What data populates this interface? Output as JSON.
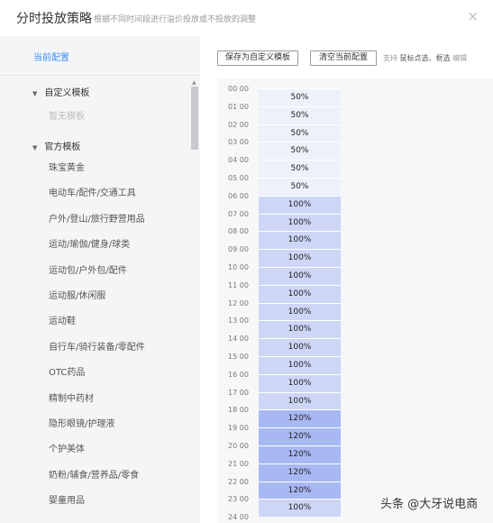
{
  "header": {
    "title": "分时投放策略",
    "subtitle": "根据不同时间段进行溢价投放或不投放的调整",
    "close_icon": "×"
  },
  "sidebar": {
    "current_config": "当前配置",
    "custom_group": {
      "label": "自定义模板",
      "empty": "暂无模板"
    },
    "official_group": {
      "label": "官方模板",
      "items": [
        "珠宝黄金",
        "电动车/配件/交通工具",
        "户外/登山/旅行野营用品",
        "运动/瑜伽/健身/球类",
        "运动包/户外包/配件",
        "运动服/休闲服",
        "运动鞋",
        "自行车/骑行装备/零配件",
        "OTC药品",
        "精制中药材",
        "隐形眼镜/护理液",
        "个护美体",
        "奶粉/辅食/营养品/零食",
        "婴童用品"
      ]
    }
  },
  "toolbar": {
    "save_label": "保存为自定义模板",
    "clear_label": "清空当前配置",
    "hint_prefix": "支持",
    "hint_highlight": "鼠标点选、框选",
    "hint_suffix": "编辑"
  },
  "schedule": {
    "hours": [
      "00 00",
      "01 00",
      "02 00",
      "03 00",
      "04 00",
      "05 00",
      "06 00",
      "07 00",
      "08 00",
      "09 00",
      "10 00",
      "11 00",
      "12 00",
      "13 00",
      "14 00",
      "15 00",
      "16 00",
      "17 00",
      "18 00",
      "19 00",
      "20 00",
      "21 00",
      "22 00",
      "23 00",
      "24 00"
    ],
    "slots": [
      "50%",
      "50%",
      "50%",
      "50%",
      "50%",
      "50%",
      "100%",
      "100%",
      "100%",
      "100%",
      "100%",
      "100%",
      "100%",
      "100%",
      "100%",
      "100%",
      "100%",
      "100%",
      "120%",
      "120%",
      "120%",
      "120%",
      "120%",
      "100%"
    ],
    "colors": {
      "50%": "#eef1fa",
      "100%": "#cdd6f7",
      "120%": "#a8b8f3"
    }
  },
  "watermark": "头条 @大牙说电商"
}
